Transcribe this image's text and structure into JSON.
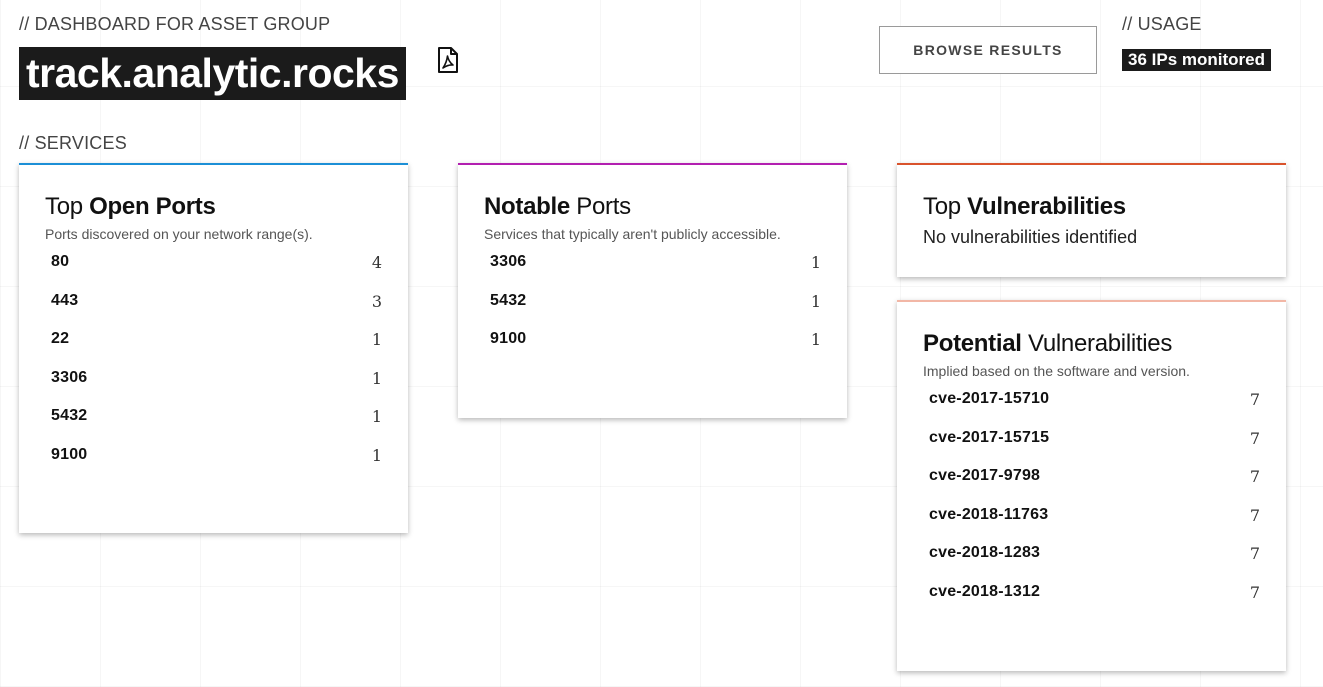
{
  "header": {
    "dashboard_label": "// DASHBOARD FOR ASSET GROUP",
    "asset_group": "track.analytic.rocks",
    "browse_button": "BROWSE RESULTS",
    "usage_label": "// USAGE",
    "usage_value": "36 IPs monitored"
  },
  "services_label": "// SERVICES",
  "colors": {
    "open_ports_accent": "#1c8fd6",
    "notable_ports_accent": "#b21fb0",
    "top_vulns_accent": "#d9532c",
    "potential_vulns_accent": "#f2b7a6"
  },
  "open_ports": {
    "title_light": "Top",
    "title_bold": "Open Ports",
    "subtitle": "Ports discovered on your network range(s).",
    "rows": [
      {
        "port": "80",
        "count": "4"
      },
      {
        "port": "443",
        "count": "3"
      },
      {
        "port": "22",
        "count": "1"
      },
      {
        "port": "3306",
        "count": "1"
      },
      {
        "port": "5432",
        "count": "1"
      },
      {
        "port": "9100",
        "count": "1"
      }
    ]
  },
  "notable_ports": {
    "title_bold": "Notable",
    "title_light": "Ports",
    "subtitle": "Services that typically aren't publicly accessible.",
    "rows": [
      {
        "port": "3306",
        "count": "1"
      },
      {
        "port": "5432",
        "count": "1"
      },
      {
        "port": "9100",
        "count": "1"
      }
    ]
  },
  "top_vulns": {
    "title_light": "Top",
    "title_bold": "Vulnerabilities",
    "empty_message": "No vulnerabilities identified"
  },
  "potential_vulns": {
    "title_bold": "Potential",
    "title_light": "Vulnerabilities",
    "subtitle": "Implied based on the software and version.",
    "rows": [
      {
        "cve": "cve-2017-15710",
        "count": "7"
      },
      {
        "cve": "cve-2017-15715",
        "count": "7"
      },
      {
        "cve": "cve-2017-9798",
        "count": "7"
      },
      {
        "cve": "cve-2018-11763",
        "count": "7"
      },
      {
        "cve": "cve-2018-1283",
        "count": "7"
      },
      {
        "cve": "cve-2018-1312",
        "count": "7"
      }
    ]
  },
  "icons": {
    "report": "pdf-icon"
  }
}
